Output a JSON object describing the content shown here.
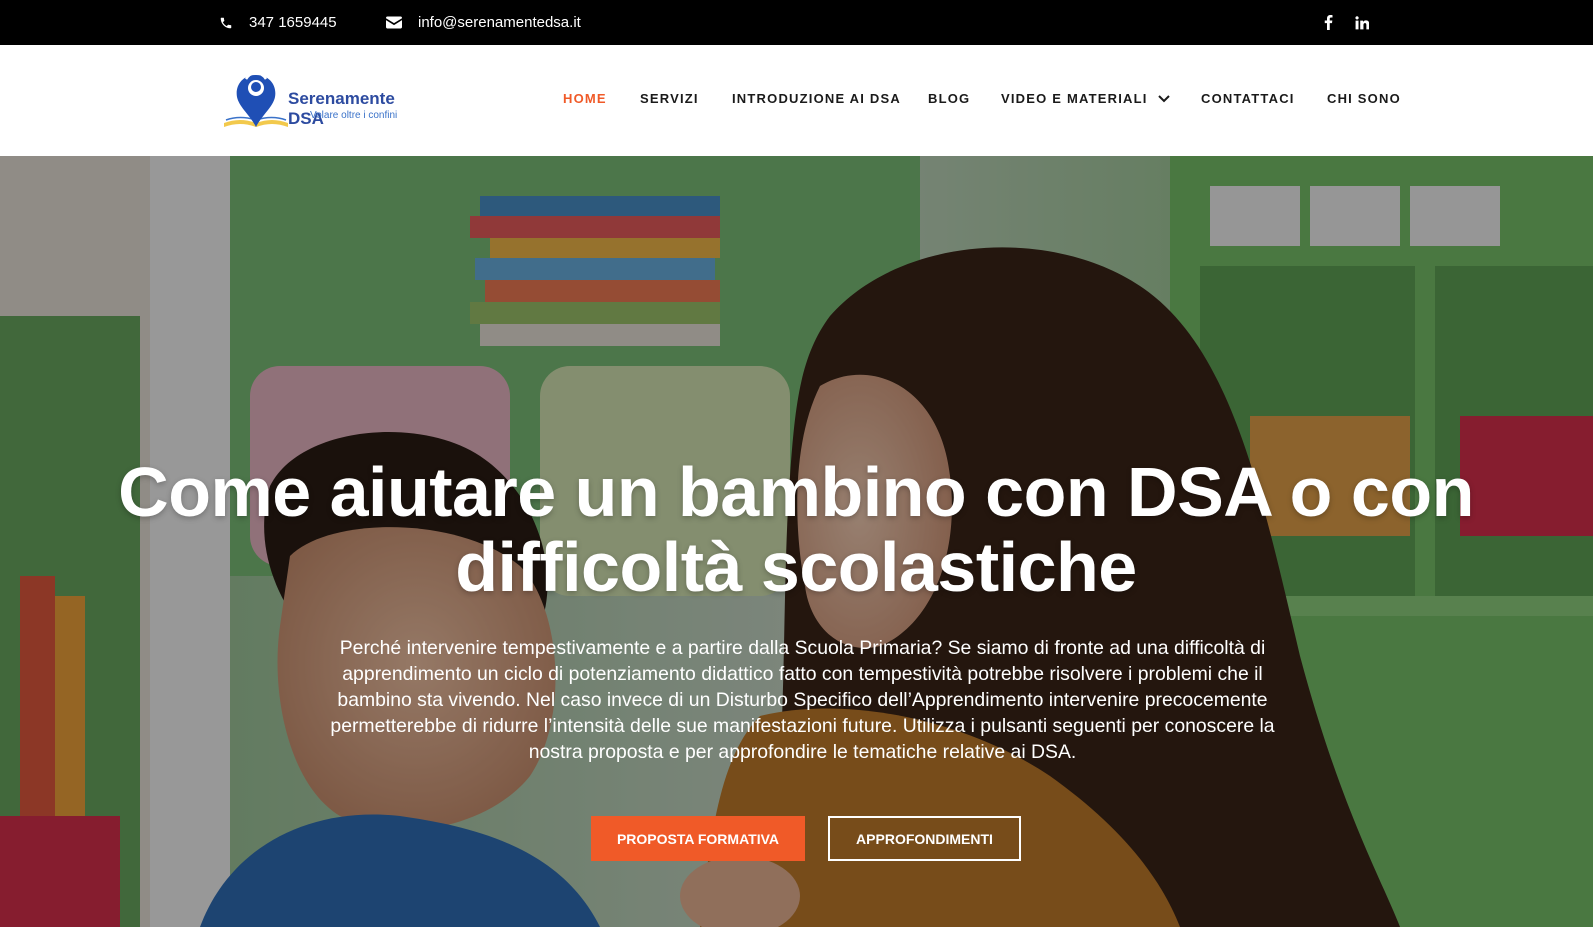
{
  "topbar": {
    "phone": "347 1659445",
    "email": "info@serenamentedsa.it",
    "social": [
      "facebook-icon",
      "linkedin-icon"
    ]
  },
  "header": {
    "logo": {
      "brand": "Serenamente DSA",
      "tagline": "Volare oltre i confini"
    },
    "nav": [
      {
        "label": "HOME",
        "active": true
      },
      {
        "label": "SERVIZI"
      },
      {
        "label": "INTRODUZIONE AI DSA"
      },
      {
        "label": "BLOG"
      },
      {
        "label": "VIDEO E MATERIALI",
        "has_dropdown": true
      },
      {
        "label": "CONTATTACI"
      },
      {
        "label": "CHI SONO"
      }
    ]
  },
  "hero": {
    "title": "Come aiutare un bambino con DSA o con difficoltà scolastiche",
    "text": "Perché intervenire tempestivamente e a partire dalla Scuola Primaria? Se siamo di fronte ad una difficoltà di apprendimento un ciclo di potenziamento didattico fatto con tempestività potrebbe risolvere i problemi che il bambino sta vivendo. Nel caso invece di un Disturbo Specifico dell’Apprendimento intervenire precocemente permetterebbe di ridurre l’intensità delle sue manifestazioni future. Utilizza i pulsanti seguenti per conoscere la nostra proposta e per approfondire le tematiche relative ai DSA.",
    "primary_button": "PROPOSTA FORMATIVA",
    "secondary_button": "APPROFONDIMENTI"
  },
  "colors": {
    "accent": "#f05a28",
    "topbar": "#000000",
    "brand_blue": "#2d4ba0"
  }
}
